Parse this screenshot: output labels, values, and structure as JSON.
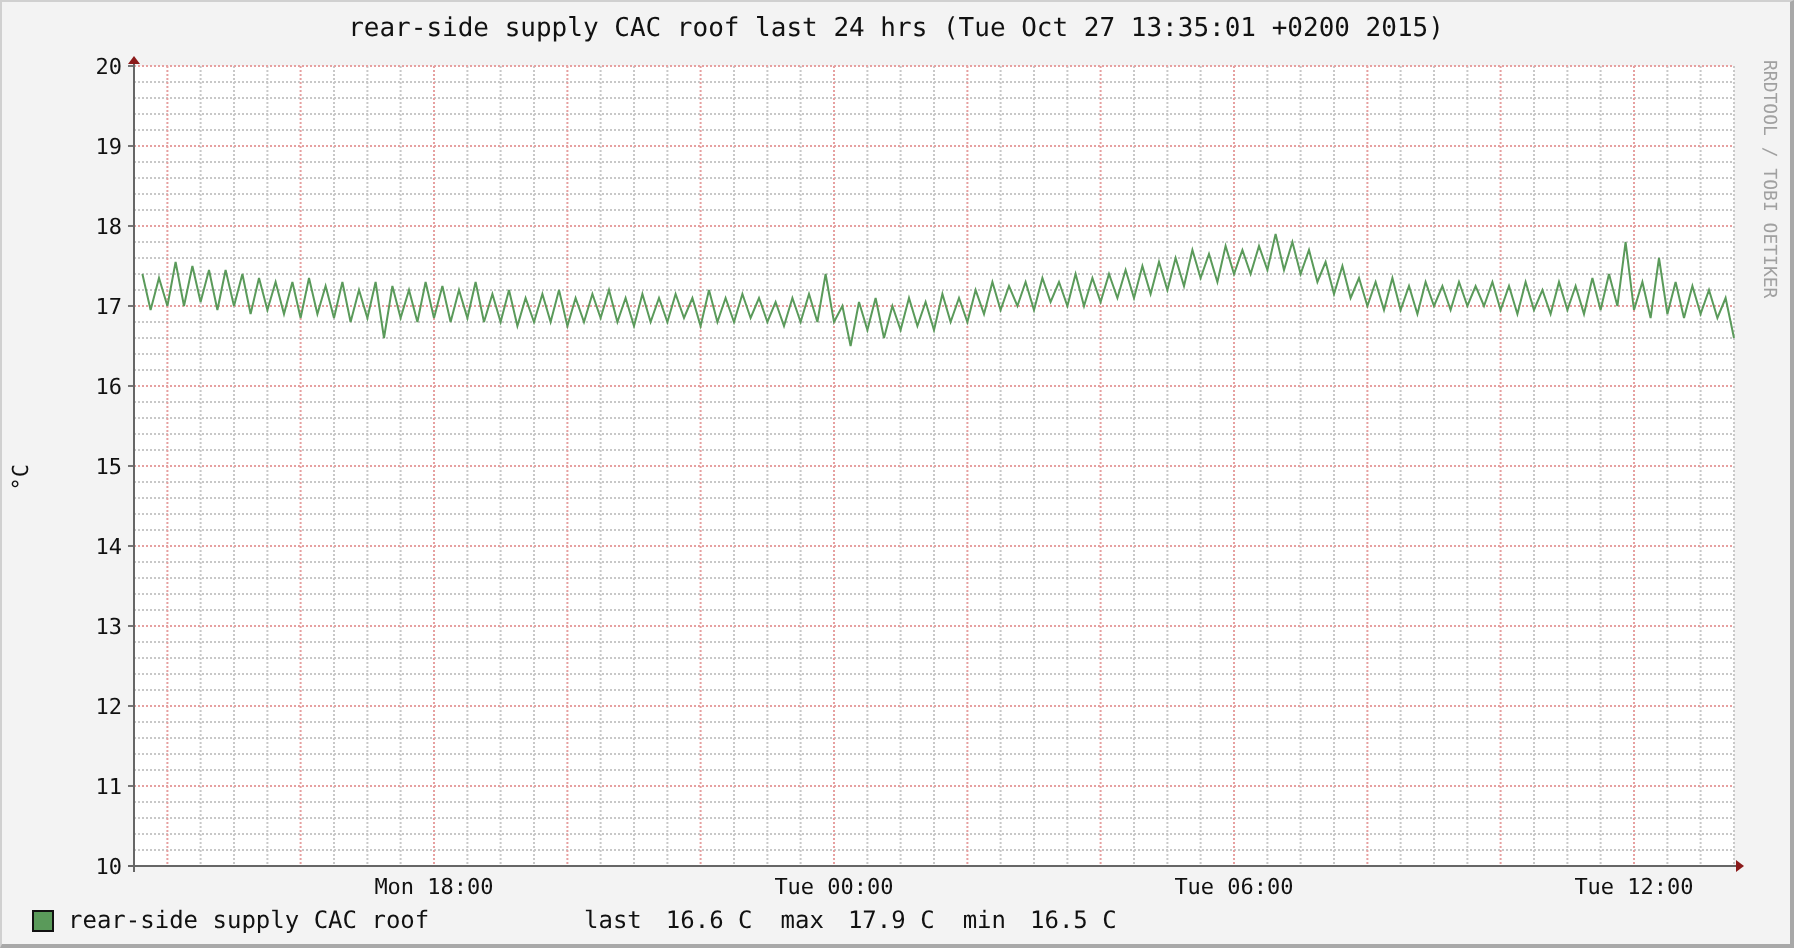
{
  "chart": {
    "credit": "RRDTOOL / TOBI OETIKER",
    "chart_data": {
      "type": "line",
      "title": "rear-side supply CAC roof last 24 hrs (Tue Oct 27 13:35:01 +0200 2015)",
      "ylabel": "°C",
      "categories": [
        null,
        null,
        null,
        null,
        null,
        null,
        null,
        null,
        null,
        null,
        null,
        null,
        null,
        null,
        null,
        null,
        null,
        null,
        null,
        null,
        null,
        null,
        null,
        null,
        null,
        null,
        null,
        null,
        null,
        null,
        null,
        null,
        null,
        null,
        null,
        "Mon 18:00",
        null,
        null,
        null,
        null,
        null,
        null,
        null,
        null,
        null,
        null,
        null,
        null,
        null,
        null,
        null,
        null,
        null,
        null,
        null,
        null,
        null,
        null,
        null,
        null,
        null,
        null,
        null,
        null,
        null,
        null,
        null,
        null,
        null,
        null,
        null,
        null,
        null,
        null,
        null,
        null,
        null,
        null,
        null,
        null,
        null,
        null,
        null,
        "Tue 00:00",
        null,
        null,
        null,
        null,
        null,
        null,
        null,
        null,
        null,
        null,
        null,
        null,
        null,
        null,
        null,
        null,
        null,
        null,
        null,
        null,
        null,
        null,
        null,
        null,
        null,
        null,
        null,
        null,
        null,
        null,
        null,
        null,
        null,
        null,
        null,
        null,
        null,
        null,
        null,
        null,
        null,
        null,
        null,
        null,
        null,
        null,
        null,
        "Tue 06:00",
        null,
        null,
        null,
        null,
        null,
        null,
        null,
        null,
        null,
        null,
        null,
        null,
        null,
        null,
        null,
        null,
        null,
        null,
        null,
        null,
        null,
        null,
        null,
        null,
        null,
        null,
        null,
        null,
        null,
        null,
        null,
        null,
        null,
        null,
        null,
        null,
        null,
        null,
        null,
        null,
        null,
        null,
        null,
        null,
        null,
        null,
        null,
        "Tue 12:00",
        null,
        null,
        null,
        null,
        null,
        null,
        null,
        null,
        null,
        null,
        null,
        null
      ],
      "series": [
        {
          "name": "rear-side supply CAC roof",
          "color": "#5a9a5a",
          "values": [
            17.4,
            16.95,
            17.35,
            17.0,
            17.55,
            17.0,
            17.5,
            17.05,
            17.45,
            16.95,
            17.45,
            17.0,
            17.4,
            16.9,
            17.35,
            16.95,
            17.3,
            16.9,
            17.3,
            16.85,
            17.35,
            16.9,
            17.25,
            16.85,
            17.3,
            16.8,
            17.2,
            16.85,
            17.3,
            16.6,
            17.25,
            16.85,
            17.2,
            16.8,
            17.3,
            16.85,
            17.25,
            16.8,
            17.2,
            16.85,
            17.3,
            16.8,
            17.15,
            16.8,
            17.2,
            16.75,
            17.1,
            16.8,
            17.15,
            16.8,
            17.2,
            16.75,
            17.1,
            16.8,
            17.15,
            16.85,
            17.2,
            16.8,
            17.1,
            16.75,
            17.15,
            16.8,
            17.1,
            16.8,
            17.15,
            16.85,
            17.1,
            16.75,
            17.2,
            16.8,
            17.1,
            16.8,
            17.15,
            16.85,
            17.1,
            16.8,
            17.05,
            16.75,
            17.1,
            16.8,
            17.15,
            16.8,
            17.4,
            16.8,
            17.0,
            16.5,
            17.05,
            16.7,
            17.1,
            16.6,
            17.0,
            16.7,
            17.1,
            16.75,
            17.05,
            16.7,
            17.15,
            16.8,
            17.1,
            16.8,
            17.2,
            16.9,
            17.3,
            16.95,
            17.25,
            17.0,
            17.3,
            16.95,
            17.35,
            17.05,
            17.3,
            17.0,
            17.4,
            17.0,
            17.35,
            17.05,
            17.4,
            17.1,
            17.45,
            17.1,
            17.5,
            17.15,
            17.55,
            17.2,
            17.6,
            17.25,
            17.7,
            17.35,
            17.65,
            17.3,
            17.75,
            17.4,
            17.7,
            17.4,
            17.75,
            17.45,
            17.9,
            17.45,
            17.8,
            17.4,
            17.7,
            17.3,
            17.55,
            17.15,
            17.5,
            17.1,
            17.35,
            17.0,
            17.3,
            16.95,
            17.35,
            16.95,
            17.25,
            16.9,
            17.3,
            17.0,
            17.25,
            16.95,
            17.3,
            17.0,
            17.25,
            17.0,
            17.3,
            16.95,
            17.25,
            16.9,
            17.3,
            16.95,
            17.2,
            16.9,
            17.3,
            16.95,
            17.25,
            16.9,
            17.35,
            16.95,
            17.4,
            17.0,
            17.8,
            16.95,
            17.3,
            16.85,
            17.6,
            16.9,
            17.3,
            16.85,
            17.25,
            16.9,
            17.2,
            16.85,
            17.1,
            16.6
          ]
        }
      ],
      "ylim": [
        10,
        20
      ],
      "grid": true,
      "yticks": [
        10,
        11,
        12,
        13,
        14,
        15,
        16,
        17,
        18,
        19,
        20
      ]
    }
  },
  "legend": {
    "stats": [
      {
        "label": "last",
        "value": "16.6 C"
      },
      {
        "label": "max",
        "value": "17.9 C"
      },
      {
        "label": "min",
        "value": "16.5 C"
      }
    ]
  }
}
